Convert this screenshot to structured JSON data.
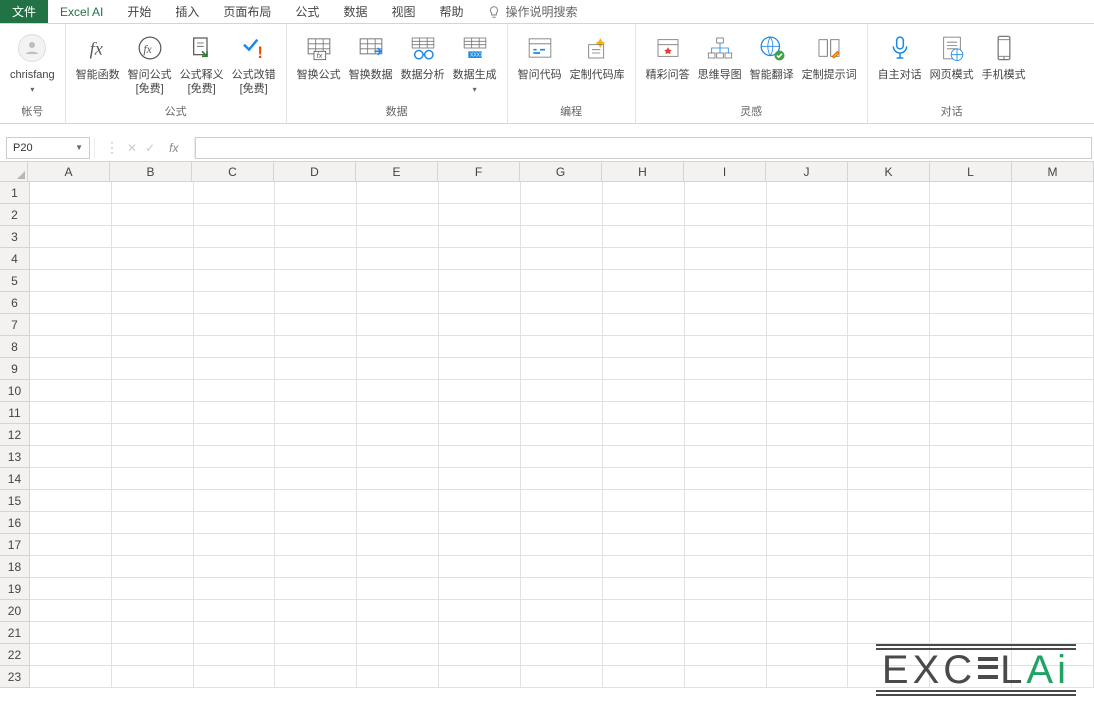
{
  "tabs": {
    "file": "文件",
    "excel_ai": "Excel AI",
    "home": "开始",
    "insert": "插入",
    "page_layout": "页面布局",
    "formulas": "公式",
    "data": "数据",
    "view": "视图",
    "help": "帮助",
    "tell_me": "操作说明搜索"
  },
  "ribbon": {
    "account": {
      "user": "chrisfang",
      "group_label": "帐号"
    },
    "formula_group": {
      "label": "公式",
      "btn1": "智能函数",
      "btn2": "智问公式\n[免费]",
      "btn3": "公式释义\n[免费]",
      "btn4": "公式改错\n[免费]"
    },
    "data_group": {
      "label": "数据",
      "btn1": "智换公式",
      "btn2": "智换数据",
      "btn3": "数据分析",
      "btn4": "数据生成"
    },
    "code_group": {
      "label": "编程",
      "btn1": "智问代码",
      "btn2": "定制代码库"
    },
    "inspire_group": {
      "label": "灵感",
      "btn1": "精彩问答",
      "btn2": "思维导图",
      "btn3": "智能翻译",
      "btn4": "定制提示词"
    },
    "dialog_group": {
      "label": "对话",
      "btn1": "自主对话",
      "btn2": "网页模式",
      "btn3": "手机模式"
    }
  },
  "formula_bar": {
    "cell_ref": "P20",
    "fx": "fx"
  },
  "grid": {
    "cols": [
      "A",
      "B",
      "C",
      "D",
      "E",
      "F",
      "G",
      "H",
      "I",
      "J",
      "K",
      "L",
      "M"
    ],
    "rows": [
      "1",
      "2",
      "3",
      "4",
      "5",
      "6",
      "7",
      "8",
      "9",
      "10",
      "11",
      "12",
      "13",
      "14",
      "15",
      "16",
      "17",
      "18",
      "19",
      "20",
      "21",
      "22",
      "23"
    ]
  },
  "watermark": {
    "text1": "EXC",
    "text2": "E",
    "text3": "L",
    "textA": "A",
    "textI": "i"
  }
}
